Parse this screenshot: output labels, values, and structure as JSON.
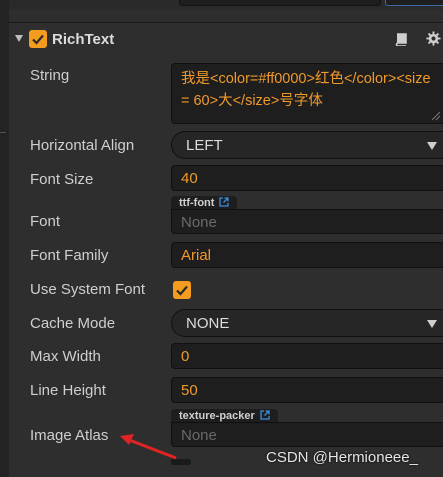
{
  "component": {
    "title": "RichText",
    "enabled": true
  },
  "properties": {
    "string": {
      "label": "String",
      "value": "我是<color=#ff0000>红色</color><size = 60>大</size>号字体"
    },
    "horizontal_align": {
      "label": "Horizontal Align",
      "value": "LEFT"
    },
    "font_size": {
      "label": "Font Size",
      "value": "40"
    },
    "font": {
      "label": "Font",
      "tag": "ttf-font",
      "placeholder": "None"
    },
    "font_family": {
      "label": "Font Family",
      "value": "Arial"
    },
    "use_system_font": {
      "label": "Use System Font",
      "checked": true
    },
    "cache_mode": {
      "label": "Cache Mode",
      "value": "NONE"
    },
    "max_width": {
      "label": "Max Width",
      "value": "0"
    },
    "line_height": {
      "label": "Line Height",
      "value": "50"
    },
    "image_atlas": {
      "label": "Image Atlas",
      "tag": "texture-packer",
      "placeholder": "None"
    }
  },
  "icons": [
    "caret-down-icon",
    "checkbox-icon",
    "book-icon",
    "gear-icon",
    "external-link-icon",
    "dropdown-arrow-icon",
    "red-arrow-icon"
  ],
  "colors": {
    "accent": "#f39c1d",
    "value_text": "#f09a2a",
    "annotation_arrow": "#e02424"
  },
  "watermark": "CSDN @Hermioneee_"
}
